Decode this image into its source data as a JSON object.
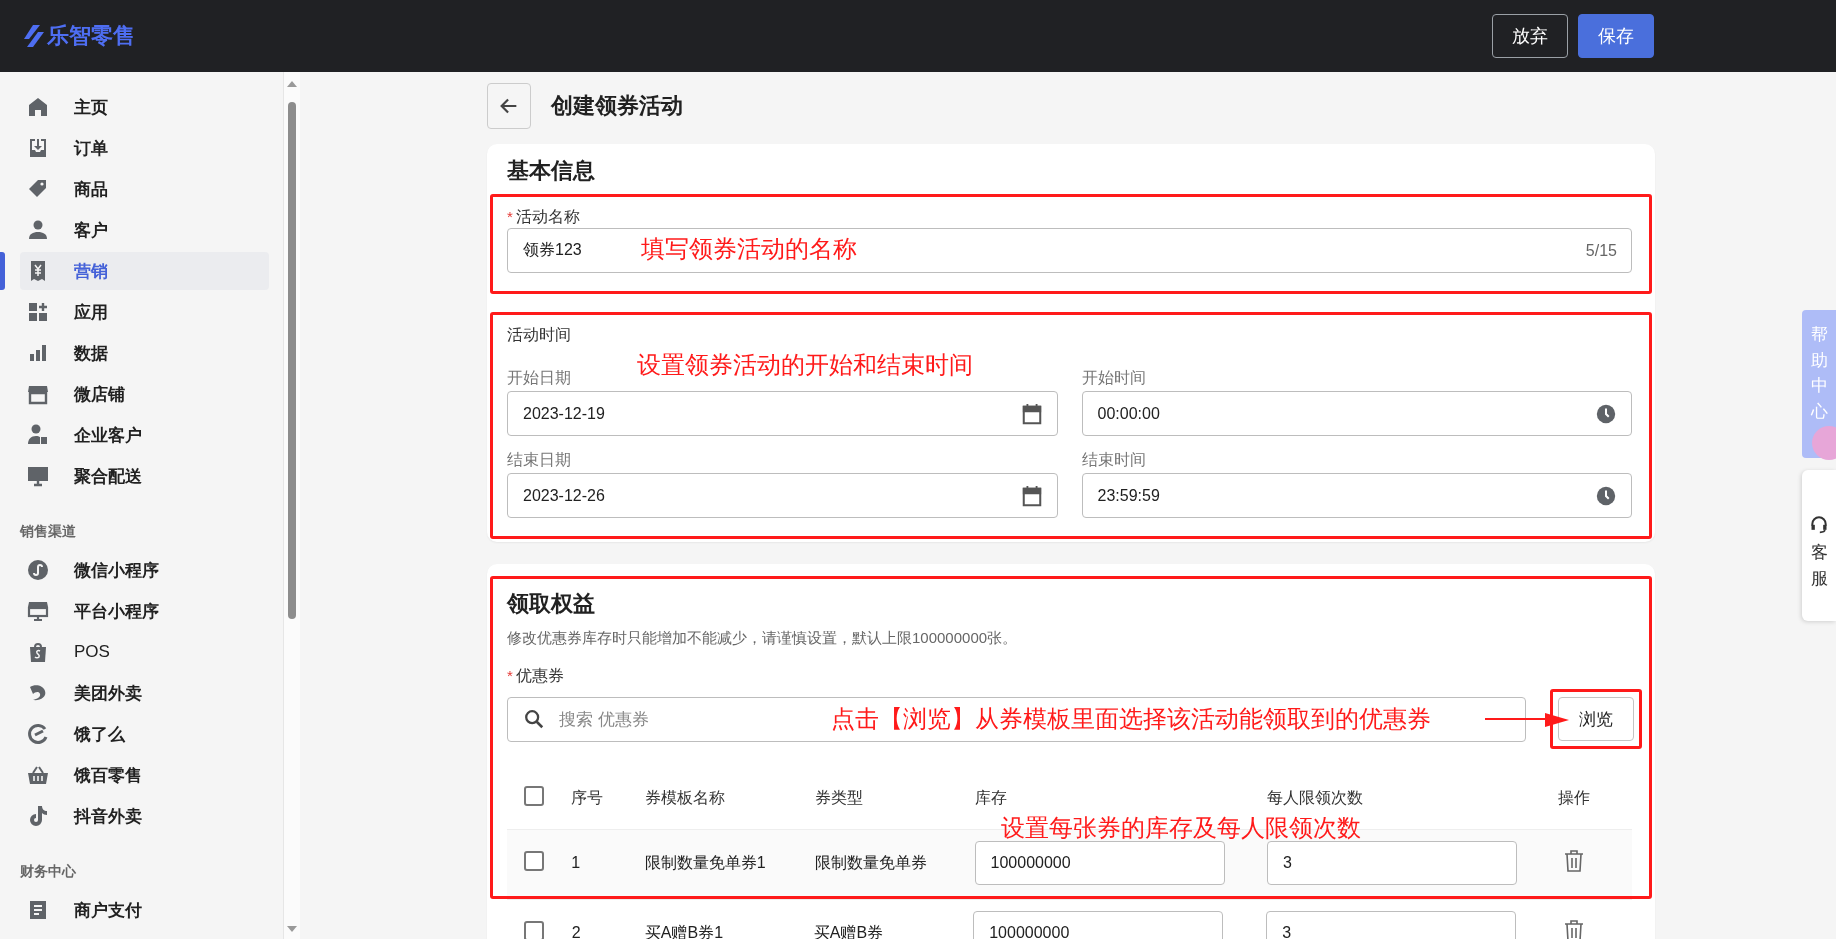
{
  "app": {
    "logo": "乐智零售"
  },
  "header_buttons": [
    {
      "label": "放弃",
      "kind": "secondary"
    },
    {
      "label": "保存",
      "kind": "primary"
    }
  ],
  "sidebar": {
    "groups": [
      {
        "items": [
          {
            "label": "主页",
            "selected": false
          },
          {
            "label": "订单",
            "selected": false
          },
          {
            "label": "商品",
            "selected": false
          },
          {
            "label": "客户",
            "selected": false
          },
          {
            "label": "营销",
            "selected": true
          },
          {
            "label": "应用",
            "selected": false
          },
          {
            "label": "数据",
            "selected": false
          },
          {
            "label": "微店铺",
            "selected": false
          },
          {
            "label": "企业客户",
            "selected": false
          },
          {
            "label": "聚合配送",
            "selected": false
          }
        ]
      },
      {
        "heading": "销售渠道",
        "items": [
          {
            "label": "微信小程序",
            "selected": false
          },
          {
            "label": "平台小程序",
            "selected": false
          },
          {
            "label": "POS",
            "selected": false
          },
          {
            "label": "美团外卖",
            "selected": false
          },
          {
            "label": "饿了么",
            "selected": false
          },
          {
            "label": "饿百零售",
            "selected": false
          },
          {
            "label": "抖音外卖",
            "selected": false
          }
        ]
      },
      {
        "heading": "财务中心",
        "items": [
          {
            "label": "商户支付",
            "selected": false
          }
        ]
      }
    ]
  },
  "page": {
    "title": "创建领券活动"
  },
  "basic_info": {
    "title": "基本信息",
    "name_field": {
      "required_mark": "*",
      "label": "活动名称",
      "value": "领券123",
      "counter": "5/15"
    },
    "name_annotation": "填写领券活动的名称",
    "time": {
      "label": "活动时间",
      "annotation": "设置领券活动的开始和结束时间",
      "fields": [
        {
          "label": "开始日期",
          "value": "2023-12-19",
          "kind": "date"
        },
        {
          "label": "开始时间",
          "value": "00:00:00",
          "kind": "time"
        },
        {
          "label": "结束日期",
          "value": "2023-12-26",
          "kind": "date"
        },
        {
          "label": "结束时间",
          "value": "23:59:59",
          "kind": "time"
        }
      ]
    }
  },
  "rewards": {
    "title": "领取权益",
    "note": "修改优惠券库存时只能增加不能减少，请谨慎设置，默认上限100000000张。",
    "coupon_field": {
      "required_mark": "*",
      "label": "优惠券",
      "placeholder": "搜索 优惠券"
    },
    "browse_button": "浏览",
    "browse_annotation": "点击【浏览】从券模板里面选择该活动能领取到的优惠券",
    "table_annotation": "设置每张券的库存及每人限领次数",
    "table": {
      "select_all_checked": false,
      "columns": [
        "序号",
        "券模板名称",
        "券类型",
        "库存",
        "每人限领次数",
        "操作"
      ],
      "rows": [
        {
          "checked": false,
          "index": "1",
          "name": "限制数量免单券1",
          "type": "限制数量免单券",
          "stock": "100000000",
          "limit": "3"
        },
        {
          "checked": false,
          "index": "2",
          "name": "买A赠B券1",
          "type": "买A赠B券",
          "stock": "100000000",
          "limit": "3"
        }
      ]
    }
  },
  "side_tabs": [
    {
      "label": "帮助中心",
      "kind": "help"
    },
    {
      "label": "客服",
      "kind": "service"
    }
  ]
}
